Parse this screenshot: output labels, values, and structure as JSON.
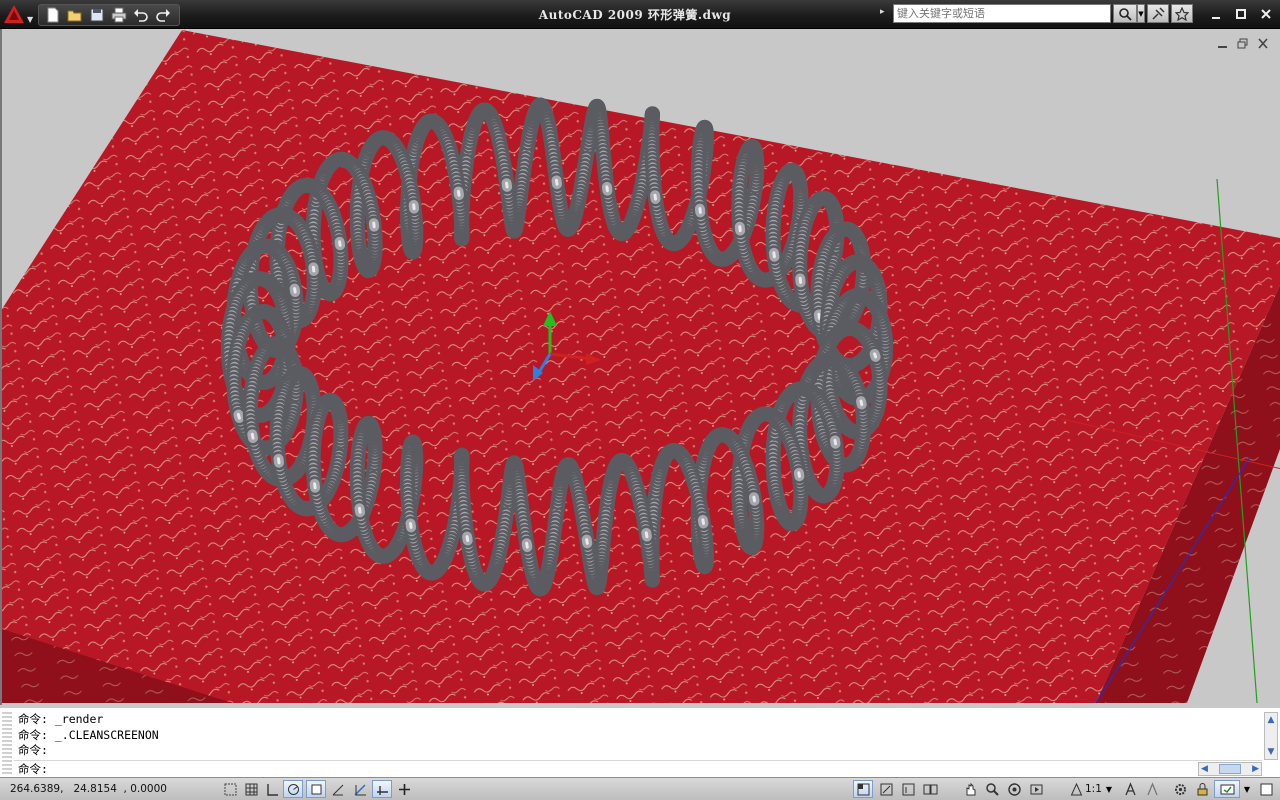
{
  "window": {
    "title": "AutoCAD 2009  环形弹簧.dwg",
    "search_placeholder": "键入关键字或短语"
  },
  "quick_access": [
    "new-icon",
    "open-icon",
    "save-icon",
    "plot-icon",
    "undo-icon",
    "redo-icon"
  ],
  "command_line": {
    "history": [
      "命令: _render",
      "命令: _.CLEANSCREENON",
      "命令:"
    ],
    "prompt": "命令:"
  },
  "status_bar": {
    "coords": "264.6389,   24.8154  , 0.0000",
    "annotation_scale": "1:1",
    "drafting_toggles": [
      "infer",
      "snap",
      "grid",
      "ortho",
      "polar",
      "osnap",
      "otrack",
      "ducs",
      "dyn",
      "lwt"
    ]
  },
  "colors": {
    "background": "#c8c8c8",
    "box_top": "#b81826",
    "box_side": "#8f0f1a",
    "spring": "#a6a7ac",
    "ucs_x": "#e02020",
    "ucs_y": "#20b020",
    "ucs_z": "#2060d0"
  }
}
